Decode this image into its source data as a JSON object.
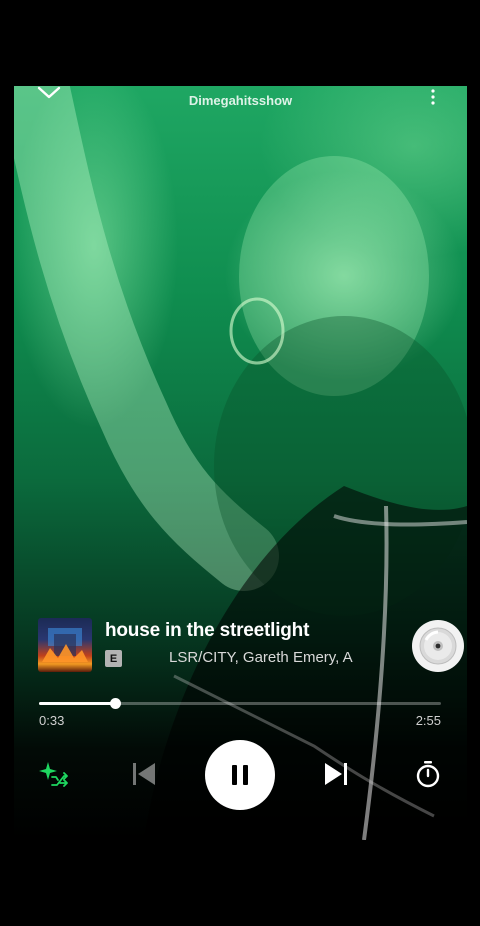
{
  "header": {
    "context_title": "Dimegahitsshow",
    "collapse_icon": "chevron-down-icon",
    "more_icon": "more-vertical-icon"
  },
  "track": {
    "title": "house in the streetlight",
    "explicit_badge": "E",
    "artists": "LSR/CITY, Gareth Emery, A",
    "cover_icon": "album-cover",
    "cd_icon": "cd-icon"
  },
  "progress": {
    "elapsed": "0:33",
    "duration": "2:55",
    "fraction": 0.1886
  },
  "controls": {
    "smart_shuffle_icon": "smart-shuffle-icon",
    "previous_icon": "skip-previous-icon",
    "play_state_icon": "pause-icon",
    "next_icon": "skip-next-icon",
    "timer_icon": "sleep-timer-icon"
  },
  "colors": {
    "accent": "#1ed760",
    "background_top": "#1fa763",
    "background_bottom": "#000000"
  }
}
